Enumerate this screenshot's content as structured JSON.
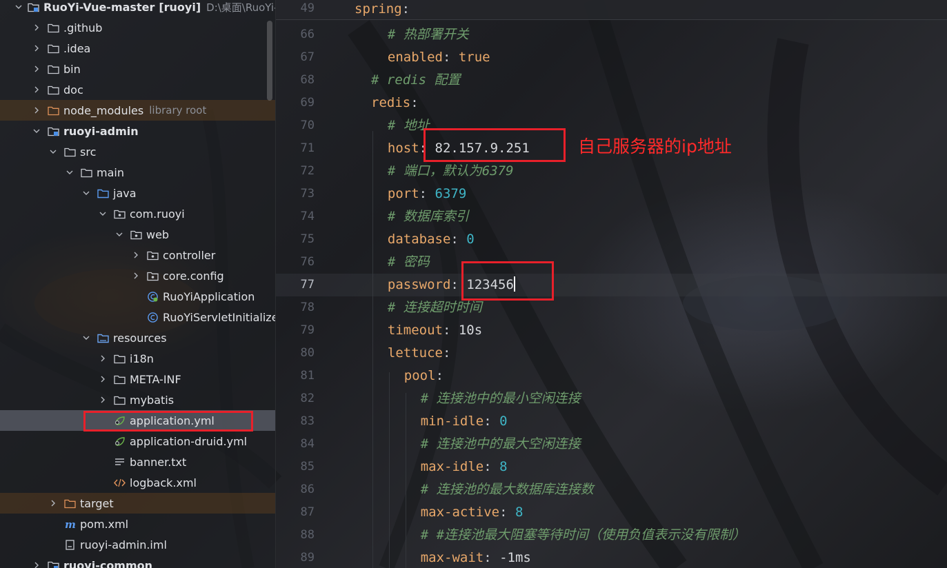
{
  "project_tree": {
    "rows": [
      {
        "label": "RuoYi-Vue-master",
        "bold": true,
        "extra": "[ruoyi]",
        "path": "D:\\桌面\\RuoYi-Vue",
        "icon": "module-folder-icon",
        "expanded": true
      },
      {
        "label": ".github",
        "icon": "folder-icon",
        "expanded": false
      },
      {
        "label": ".idea",
        "icon": "folder-icon",
        "expanded": false
      },
      {
        "label": "bin",
        "icon": "folder-icon",
        "expanded": false
      },
      {
        "label": "doc",
        "icon": "folder-icon",
        "expanded": false
      },
      {
        "label": "node_modules",
        "extra": "library root",
        "icon": "excluded-folder-icon",
        "expanded": false,
        "excluded": true
      },
      {
        "label": "ruoyi-admin",
        "bold": true,
        "icon": "module-folder-icon",
        "expanded": true
      },
      {
        "label": "src",
        "icon": "folder-icon",
        "expanded": true
      },
      {
        "label": "main",
        "icon": "folder-icon",
        "expanded": true
      },
      {
        "label": "java",
        "icon": "source-folder-icon",
        "expanded": true
      },
      {
        "label": "com.ruoyi",
        "icon": "package-icon",
        "expanded": true
      },
      {
        "label": "web",
        "icon": "package-icon",
        "expanded": true
      },
      {
        "label": "controller",
        "icon": "package-icon",
        "expanded": false
      },
      {
        "label": "core.config",
        "icon": "package-icon",
        "expanded": false
      },
      {
        "label": "RuoYiApplication",
        "icon": "spring-class-icon"
      },
      {
        "label": "RuoYiServletInitializer",
        "icon": "class-icon"
      },
      {
        "label": "resources",
        "icon": "resources-folder-icon",
        "expanded": true
      },
      {
        "label": "i18n",
        "icon": "folder-icon",
        "expanded": false
      },
      {
        "label": "META-INF",
        "icon": "folder-icon",
        "expanded": false
      },
      {
        "label": "mybatis",
        "icon": "folder-icon",
        "expanded": false
      },
      {
        "label": "application.yml",
        "icon": "spring-yml-icon",
        "selected": true
      },
      {
        "label": "application-druid.yml",
        "icon": "spring-yml-icon"
      },
      {
        "label": "banner.txt",
        "icon": "text-file-icon"
      },
      {
        "label": "logback.xml",
        "icon": "xml-file-icon"
      },
      {
        "label": "target",
        "icon": "excluded-folder-icon",
        "expanded": false,
        "excluded": true
      },
      {
        "label": "pom.xml",
        "icon": "maven-icon"
      },
      {
        "label": "ruoyi-admin.iml",
        "icon": "iml-file-icon"
      },
      {
        "label": "ruoyi-common",
        "bold": true,
        "icon": "module-folder-icon",
        "expanded": false
      }
    ]
  },
  "editor": {
    "sticky_line": {
      "num": "49",
      "key": "spring"
    },
    "lines": [
      {
        "num": "66",
        "comment": "# 热部署开关"
      },
      {
        "num": "67",
        "key": "enabled",
        "value": "true",
        "vtype": "bool"
      },
      {
        "num": "68",
        "comment": "# redis 配置"
      },
      {
        "num": "69",
        "key": "redis"
      },
      {
        "num": "70",
        "comment": "# 地址"
      },
      {
        "num": "71",
        "key": "host",
        "value": "82.157.9.251",
        "vtype": "str"
      },
      {
        "num": "72",
        "comment": "# 端口，默认为6379"
      },
      {
        "num": "73",
        "key": "port",
        "value": "6379",
        "vtype": "num"
      },
      {
        "num": "74",
        "comment": "# 数据库索引"
      },
      {
        "num": "75",
        "key": "database",
        "value": "0",
        "vtype": "num"
      },
      {
        "num": "76",
        "comment": "# 密码"
      },
      {
        "num": "77",
        "key": "password",
        "value": "123456",
        "vtype": "str",
        "current": true
      },
      {
        "num": "78",
        "comment": "# 连接超时时间"
      },
      {
        "num": "79",
        "key": "timeout",
        "value": "10s",
        "vtype": "str"
      },
      {
        "num": "80",
        "key": "lettuce"
      },
      {
        "num": "81",
        "key": "pool"
      },
      {
        "num": "82",
        "comment": "# 连接池中的最小空闲连接"
      },
      {
        "num": "83",
        "key": "min-idle",
        "value": "0",
        "vtype": "num"
      },
      {
        "num": "84",
        "comment": "# 连接池中的最大空闲连接"
      },
      {
        "num": "85",
        "key": "max-idle",
        "value": "8",
        "vtype": "num"
      },
      {
        "num": "86",
        "comment": "# 连接池的最大数据库连接数"
      },
      {
        "num": "87",
        "key": "max-active",
        "value": "8",
        "vtype": "num"
      },
      {
        "num": "88",
        "comment": "# #连接池最大阻塞等待时间（使用负值表示没有限制）"
      },
      {
        "num": "89",
        "key": "max-wait",
        "value": "-1ms",
        "vtype": "str"
      }
    ]
  },
  "annotations": {
    "host_note": "自己服务器的ip地址"
  },
  "colors": {
    "annotation": "#e8202a",
    "yaml_key": "#e8a86a",
    "comment": "#6e9c6c",
    "number": "#3fb5c6"
  }
}
